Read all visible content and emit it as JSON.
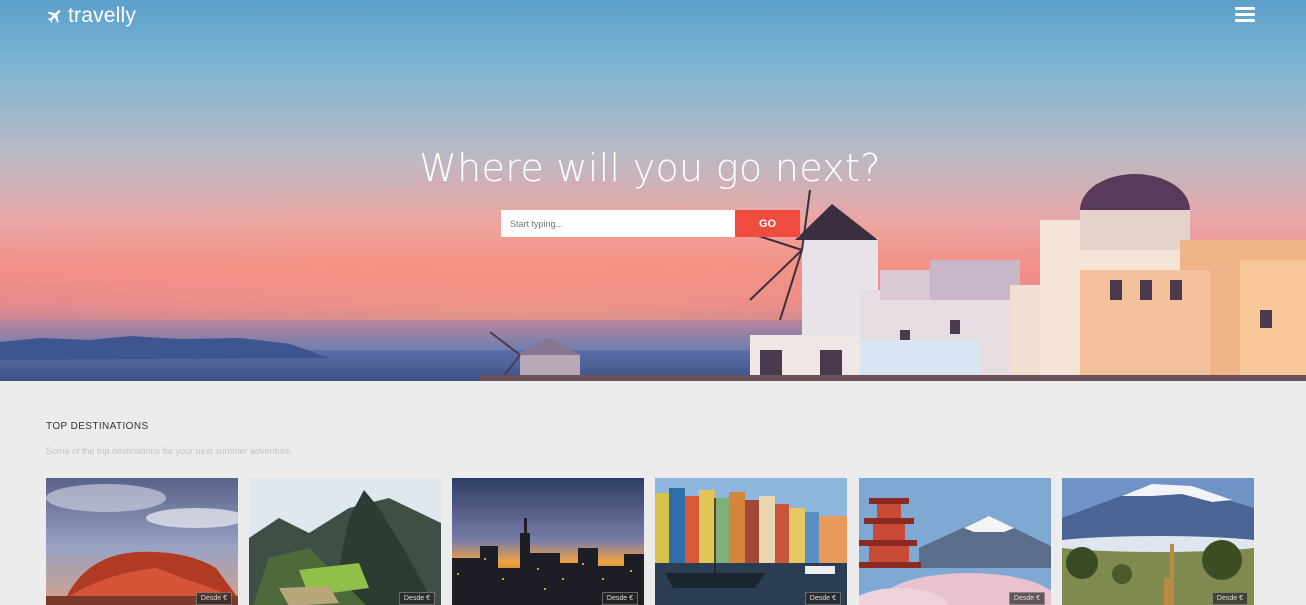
{
  "header": {
    "logo_text": "travelly",
    "logo_icon": "plane-icon",
    "menu_icon": "hamburger-menu-icon"
  },
  "hero": {
    "title": "Where will you go next?",
    "search_placeholder": "Start typing...",
    "search_value": "",
    "go_label": "GO"
  },
  "destinations": {
    "title": "TOP DESTINATIONS",
    "subtitle": "Some of the top destinations for your next summer adventure.",
    "items": [
      {
        "scene": "uluru",
        "price_label": "Desde €"
      },
      {
        "scene": "machu-picchu",
        "price_label": "Desde €"
      },
      {
        "scene": "city-skyline",
        "price_label": "Desde €"
      },
      {
        "scene": "copenhagen-harbor",
        "price_label": "Desde €"
      },
      {
        "scene": "fuji-pagoda",
        "price_label": "Desde €"
      },
      {
        "scene": "kilimanjaro",
        "price_label": "Desde €"
      }
    ]
  },
  "colors": {
    "accent": "#ef4c3f",
    "page_background": "#ececec"
  }
}
